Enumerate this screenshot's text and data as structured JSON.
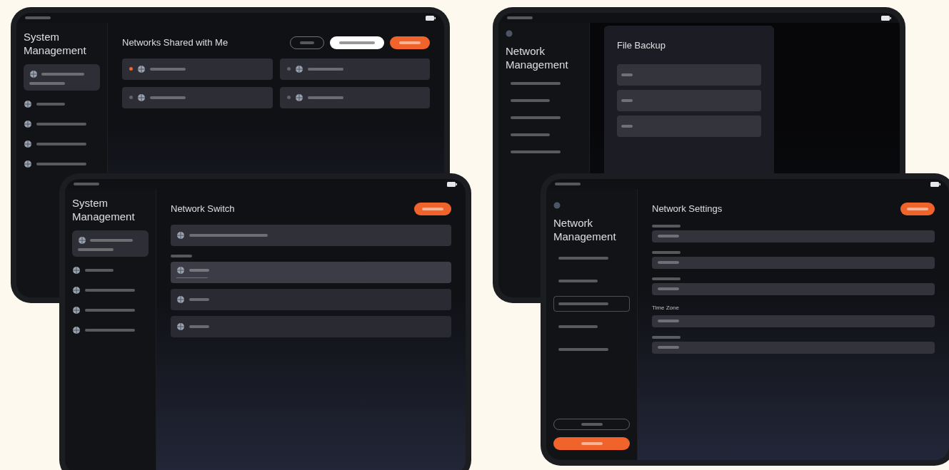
{
  "tablets": [
    {
      "kind": "shared",
      "sidebar_title": "System Management",
      "title": "Networks Shared with Me"
    },
    {
      "kind": "backup",
      "sidebar_title": "Network Management",
      "modal_title": "File Backup"
    },
    {
      "kind": "switch",
      "sidebar_title": "System Management",
      "title": "Network Switch",
      "networks": [
        {
          "selected": true
        },
        {
          "selected": false
        },
        {
          "selected": false
        }
      ]
    },
    {
      "kind": "settings",
      "sidebar_title": "Network Management",
      "title": "Network Settings",
      "time_zone_label": "Time Zone",
      "nav": [
        {
          "selected": false
        },
        {
          "selected": false
        },
        {
          "selected": true
        },
        {
          "selected": false
        },
        {
          "selected": false
        }
      ]
    }
  ]
}
